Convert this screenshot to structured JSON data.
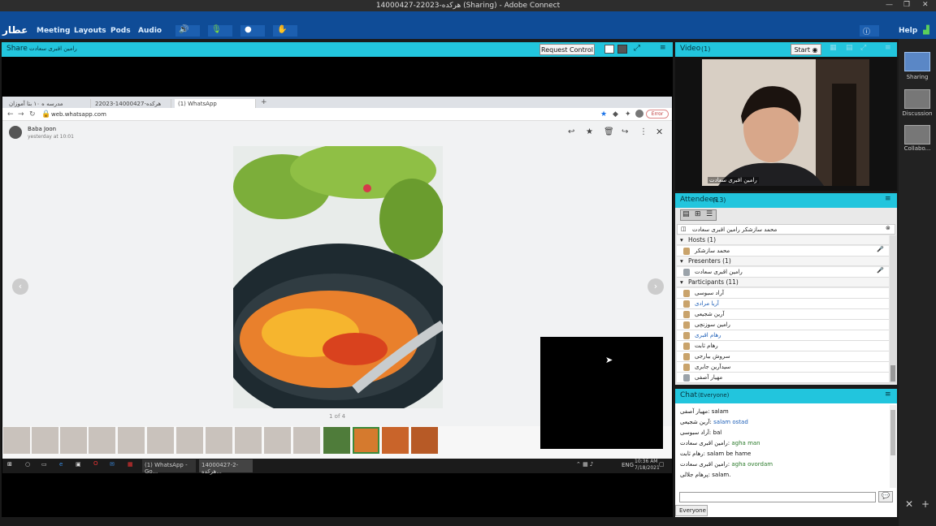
{
  "window": {
    "title": "14000427-22023-هرکده (Sharing) - Adobe Connect"
  },
  "menu": {
    "logo": "عطار",
    "items": [
      "Meeting",
      "Layouts",
      "Pods",
      "Audio"
    ],
    "help": "Help"
  },
  "share_pod": {
    "title": "Share",
    "presenter": "رامین اقبری سعادت",
    "request_control": "Request Control"
  },
  "browser": {
    "tabs": [
      "مدرسه ه ۱۰ بتا آموزان",
      "22023-هرکده-14000427",
      "(1) WhatsApp"
    ],
    "url": "web.whatsapp.com",
    "error_badge": "Error",
    "sender": "Baba Joon",
    "sent_time": "yesterday at 10:01",
    "counter": "1 of 4"
  },
  "taskbar": {
    "whatsapp_item": "(1) WhatsApp - Go...",
    "connect_item": "14000427-2-هرکده...",
    "lang": "ENG",
    "time": "10:36 AM",
    "date": "7/18/2021"
  },
  "video_pod": {
    "title": "Video",
    "count": "(1)",
    "start_label": "Start",
    "caption": "رامین اقبری سعادت"
  },
  "attendees_pod": {
    "title": "Attendees",
    "count": "(13)",
    "current_user": "محمد سازشکر رامین اقبری سعادت",
    "groups": [
      {
        "label": "Hosts (1)",
        "members": [
          "محمد سازشکر"
        ]
      },
      {
        "label": "Presenters (1)",
        "members": [
          "رامین اقبری سعادت"
        ]
      },
      {
        "label": "Participants (11)",
        "members": [
          "آراد سبوسی",
          "آریا مرادی",
          "آرین شجیعی",
          "رامین سوزنچی",
          "رهام اقبری",
          "رهام ثابت",
          "سروش بیارجی",
          "سیدآرین جابری",
          "مهیار آصفی"
        ]
      }
    ]
  },
  "chat_pod": {
    "title": "Chat",
    "scope": "(Everyone)",
    "messages": [
      {
        "sender": "مهیار آصفی:",
        "text": "salam"
      },
      {
        "sender": "آرین شجیعی:",
        "text": "salam ostad"
      },
      {
        "sender": "آراد سبوسی:",
        "text": "bal"
      },
      {
        "sender": "رامین اقبری سعادت:",
        "text": "agha man"
      },
      {
        "sender": "رهام ثابت:",
        "text": "salam be hame"
      },
      {
        "sender": "رامین اقبری سعادت:",
        "text": "agha ovordam"
      },
      {
        "sender": "پرهام جلالی:",
        "text": "salam."
      }
    ],
    "recipient": "Everyone"
  },
  "layouts": [
    {
      "label": "Sharing"
    },
    {
      "label": "Discussion"
    },
    {
      "label": "Collabo..."
    }
  ]
}
